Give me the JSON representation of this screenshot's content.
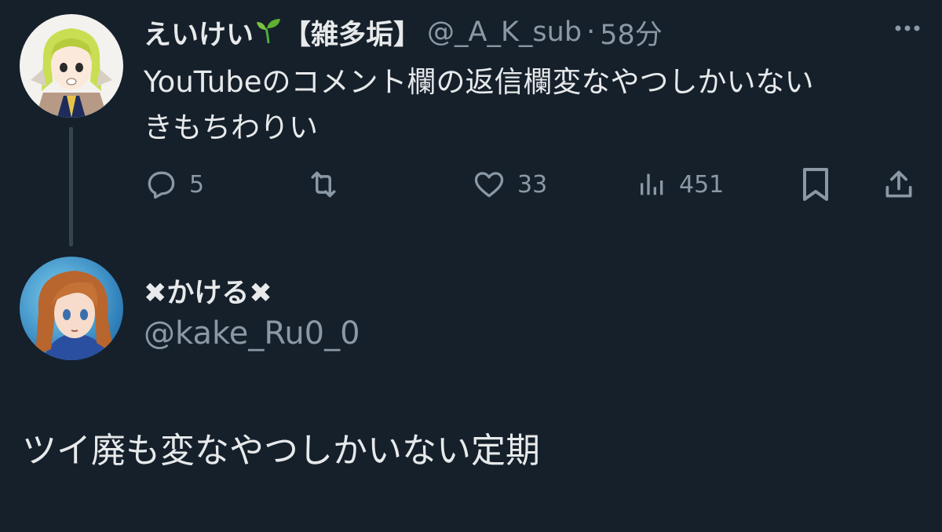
{
  "tweet": {
    "display_name": "えいけい",
    "display_name_tag": "【雑多垢】",
    "sprout_icon": "seedling-emoji-icon",
    "handle": "@_A_K_sub",
    "separator": "·",
    "time": "58分",
    "text_line1": "YouTubeのコメント欄の返信欄変なやつしかいない",
    "text_line2": "きもちわりい",
    "actions": {
      "reply_count": "5",
      "retweet_count": "",
      "like_count": "33",
      "views_count": "451"
    }
  },
  "reply": {
    "display_name": "✖かける✖",
    "handle": "@kake_Ru0_0",
    "text": "ツイ廃も変なやつしかいない定期"
  },
  "colors": {
    "background": "#15202b",
    "primary_text": "#e7e9ea",
    "secondary_text": "#8b98a5",
    "thread_line": "#38444d"
  }
}
